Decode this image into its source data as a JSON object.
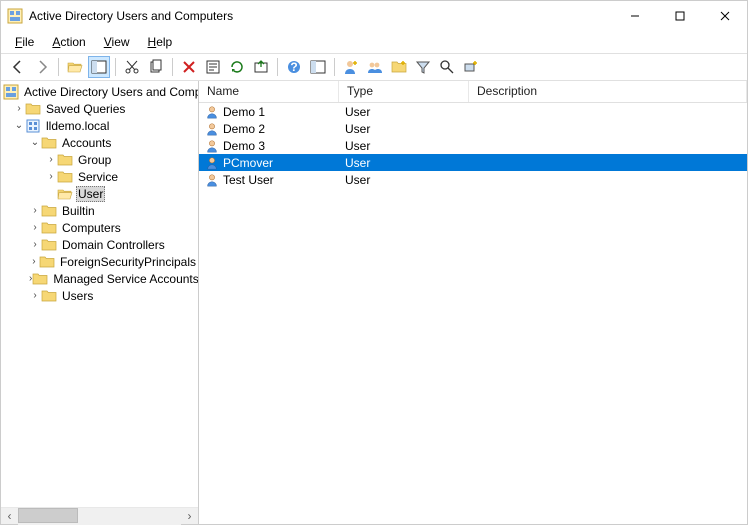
{
  "window": {
    "title": "Active Directory Users and Computers"
  },
  "menu": {
    "file": "File",
    "action": "Action",
    "view": "View",
    "help": "Help"
  },
  "tree": {
    "root": "Active Directory Users and Computers",
    "saved_queries": "Saved Queries",
    "domain": "lldemo.local",
    "accounts": "Accounts",
    "group": "Group",
    "service": "Service",
    "user": "User",
    "builtin": "Builtin",
    "computers": "Computers",
    "domain_controllers": "Domain Controllers",
    "fsp": "ForeignSecurityPrincipals",
    "msa": "Managed Service Accounts",
    "users": "Users"
  },
  "columns": {
    "name": "Name",
    "type": "Type",
    "description": "Description"
  },
  "rows": [
    {
      "name": "Demo 1",
      "type": "User",
      "description": "",
      "selected": false
    },
    {
      "name": "Demo 2",
      "type": "User",
      "description": "",
      "selected": false
    },
    {
      "name": "Demo 3",
      "type": "User",
      "description": "",
      "selected": false
    },
    {
      "name": "PCmover",
      "type": "User",
      "description": "",
      "selected": true
    },
    {
      "name": "Test User",
      "type": "User",
      "description": "",
      "selected": false
    }
  ]
}
